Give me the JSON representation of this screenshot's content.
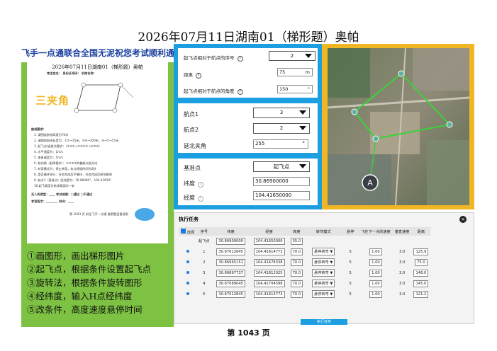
{
  "page_title": "2026年07月11日湖南01（梯形题）奥帕",
  "footer": "第 1043 页",
  "left": {
    "banner": "飞手一点通联合全国无泥祝您考试顺利通过",
    "doc_title": "2026年07月11日湖南01（梯形题）奥帕",
    "doc_fields": "考生姓名：        身份证号码：        机构名称：",
    "stamp": "三夹角",
    "doc_lines": [
      "航线要求：",
      "1.  请围绕航线高度为70米",
      "2.  请围绕航线长度为：①②→15米，③④→100米，④→①→15米",
      "3.  起飞点/返航点要求：（①②①→②③④①→②③④）",
      "4.  水平速度为：1m/s",
      "5.  垂直速度为：5m/s",
      "6.  航向角（起降要求）：①②③④的偏航以航方向",
      "7.  转弯模式为：停止转弯，各点停留时间为0秒",
      "8.  是否循环执行：任务完成后不循环，任务完成后原地悬停",
      "9.  航点1（基准点）经纬度为：30.86900°，104.41650°",
      "10.起飞高度为航线高度的一半",
      "无人机类型：____  考试成绩：□通过 □不通过",
      "考官签字：________  时间：____",
      "第 1043 页  前往飞手一点通 搜索题目看答案"
    ],
    "steps": [
      "①画图形，画出梯形图片",
      "②起飞点，根据条件设置起飞点",
      "③旋转法，根据条件旋转图形",
      "④经纬度，输入H点经纬度",
      "⑤改条件，高度速度悬停时间"
    ]
  },
  "middle": {
    "card1": {
      "seq_label": "起飞点相对于航点的序号",
      "seq_value": "2",
      "distance_label": "距离",
      "distance_value": "75",
      "distance_unit": "m",
      "angle_label": "起飞点相对于航点的角度",
      "angle_value": "150",
      "angle_unit": "°"
    },
    "card2": {
      "wp1_label": "航点1",
      "wp1_value": "3",
      "wp2_label": "航点2",
      "wp2_value": "2",
      "north_label": "延北夹角",
      "north_value": "255",
      "north_unit": "°"
    },
    "card3": {
      "base_label": "基准点",
      "base_value": "起飞点",
      "lat_label": "纬度",
      "lat_value": "30.86900000",
      "lon_label": "经度",
      "lon_value": "104.41650000"
    }
  },
  "map": {
    "marker_label": "A",
    "route_color": "#39d339"
  },
  "task": {
    "title": "执行任务",
    "close": "×",
    "columns": [
      "选择",
      "序号",
      "纬度",
      "经度",
      "高度",
      "转弯模式",
      "悬停",
      "飞往下一点的速度",
      "垂直速度",
      "距离"
    ],
    "takeoff_row": {
      "seq": "起飞点",
      "lat": "30.86900000",
      "lon": "104.41650000",
      "alt": "35.0"
    },
    "rows": [
      {
        "seq": "1",
        "lat": "30.87012845",
        "lon": "104.41614773",
        "alt": "70.0",
        "turn": "悬停转弯",
        "hover": "5",
        "speed": "1.00",
        "vspeed": "3.0",
        "dist": "125.9"
      },
      {
        "seq": "2",
        "lat": "30.86965151",
        "lon": "104.41678338",
        "alt": "70.0",
        "turn": "悬停转弯",
        "hover": "5",
        "speed": "1.00",
        "vspeed": "3.0",
        "dist": "75.0"
      },
      {
        "seq": "3",
        "lat": "30.86897737",
        "lon": "104.41812025",
        "alt": "70.0",
        "turn": "悬停转弯",
        "hover": "5",
        "speed": "1.00",
        "vspeed": "3.0",
        "dist": "148.0"
      },
      {
        "seq": "4",
        "lat": "30.87089045",
        "lon": "104.41704598",
        "alt": "70.0",
        "turn": "悬停转弯",
        "hover": "5",
        "speed": "1.00",
        "vspeed": "3.0",
        "dist": "145.0"
      },
      {
        "seq": "5",
        "lat": "30.87012845",
        "lon": "104.41614773",
        "alt": "70.0",
        "turn": "悬停转弯",
        "hover": "5",
        "speed": "1.00",
        "vspeed": "3.0",
        "dist": "121.2"
      }
    ],
    "execute_label": "执行任务"
  }
}
